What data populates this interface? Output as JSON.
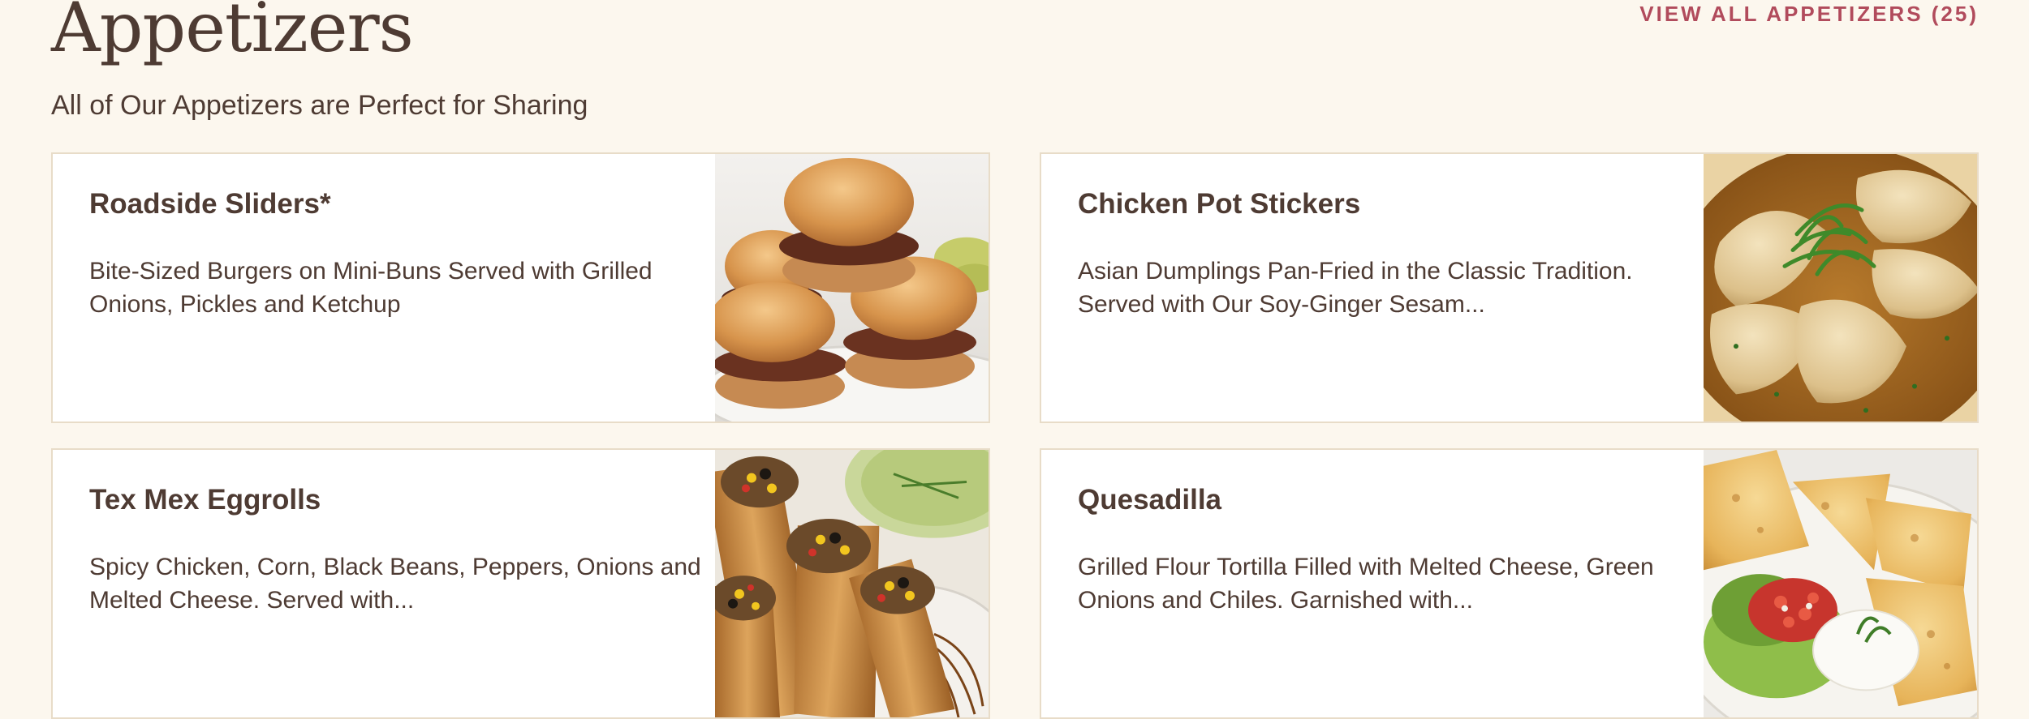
{
  "section": {
    "title": "Appetizers",
    "subtitle": "All of Our Appetizers are Perfect for Sharing",
    "view_all_label": "VIEW ALL APPETIZERS (25)"
  },
  "items": [
    {
      "name": "Roadside Sliders*",
      "description": "Bite-Sized Burgers on Mini-Buns Served with Grilled Onions, Pickles and Ketchup",
      "photo": "roadside-sliders-photo"
    },
    {
      "name": "Chicken Pot Stickers",
      "description": "Asian Dumplings Pan-Fried in the Classic Tradition. Served with Our Soy-Ginger Sesam...",
      "photo": "chicken-pot-stickers-photo"
    },
    {
      "name": "Tex Mex Eggrolls",
      "description": "Spicy Chicken, Corn, Black Beans, Peppers, Onions and Melted Cheese. Served with...",
      "photo": "tex-mex-eggrolls-photo"
    },
    {
      "name": "Quesadilla",
      "description": "Grilled Flour Tortilla Filled with Melted Cheese, Green Onions and Chiles. Garnished with...",
      "photo": "quesadilla-photo"
    }
  ],
  "colors": {
    "background": "#fcf7ee",
    "text": "#4e3b33",
    "accent": "#b14b5c",
    "card_border": "#e8dcc8"
  }
}
